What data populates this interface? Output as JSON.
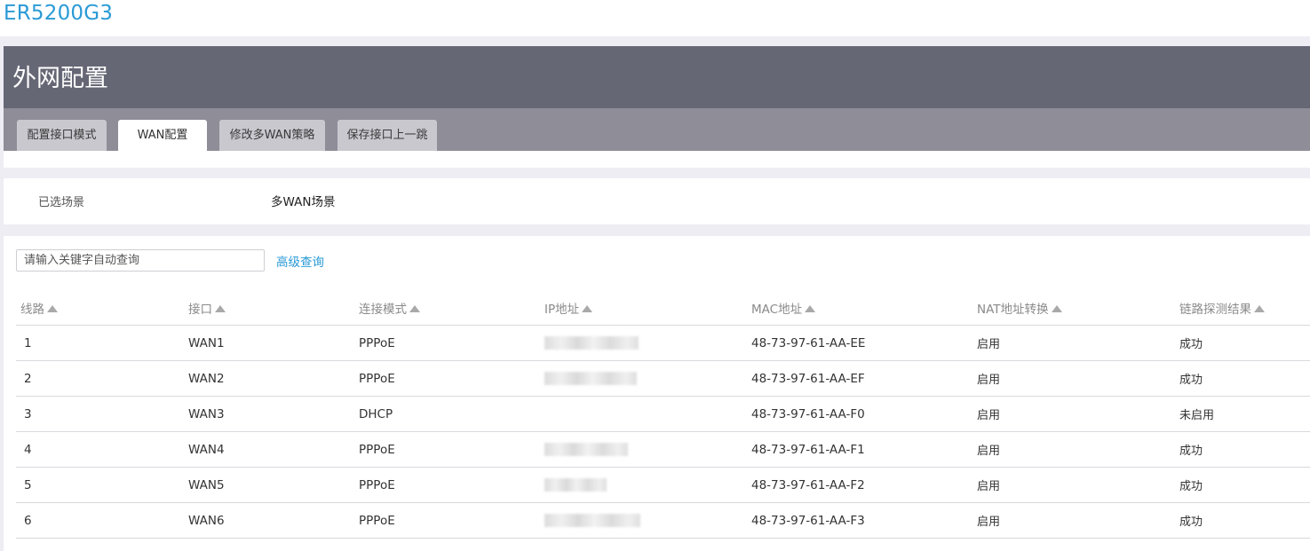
{
  "app": {
    "title": "ER5200G3"
  },
  "header": {
    "title": "外网配置"
  },
  "tabs": [
    {
      "label": "配置接口模式",
      "active": false
    },
    {
      "label": "WAN配置",
      "active": true
    },
    {
      "label": "修改多WAN策略",
      "active": false
    },
    {
      "label": "保存接口上一跳",
      "active": false
    }
  ],
  "scene": {
    "label": "已选场景",
    "value": "多WAN场景"
  },
  "search": {
    "placeholder": "请输入关键字自动查询",
    "value": "",
    "advanced_label": "高级查询"
  },
  "table": {
    "columns": [
      "线路",
      "接口",
      "连接模式",
      "IP地址",
      "MAC地址",
      "NAT地址转换",
      "链路探测结果"
    ],
    "rows": [
      {
        "line": "1",
        "iface": "WAN1",
        "mode": "PPPoE",
        "ip_redacted": true,
        "mac": "48-73-97-61-AA-EE",
        "nat": "启用",
        "probe": "成功"
      },
      {
        "line": "2",
        "iface": "WAN2",
        "mode": "PPPoE",
        "ip_redacted": true,
        "mac": "48-73-97-61-AA-EF",
        "nat": "启用",
        "probe": "成功"
      },
      {
        "line": "3",
        "iface": "WAN3",
        "mode": "DHCP",
        "ip_redacted": false,
        "mac": "48-73-97-61-AA-F0",
        "nat": "启用",
        "probe": "未启用"
      },
      {
        "line": "4",
        "iface": "WAN4",
        "mode": "PPPoE",
        "ip_redacted": true,
        "mac": "48-73-97-61-AA-F1",
        "nat": "启用",
        "probe": "成功"
      },
      {
        "line": "5",
        "iface": "WAN5",
        "mode": "PPPoE",
        "ip_redacted": true,
        "mac": "48-73-97-61-AA-F2",
        "nat": "启用",
        "probe": "成功"
      },
      {
        "line": "6",
        "iface": "WAN6",
        "mode": "PPPoE",
        "ip_redacted": true,
        "mac": "48-73-97-61-AA-F3",
        "nat": "启用",
        "probe": "成功"
      }
    ]
  },
  "colors": {
    "brand": "#2a9ad6",
    "header_bg": "#666775",
    "tabs_bg": "#8e8d98",
    "link": "#2a9ad6"
  }
}
